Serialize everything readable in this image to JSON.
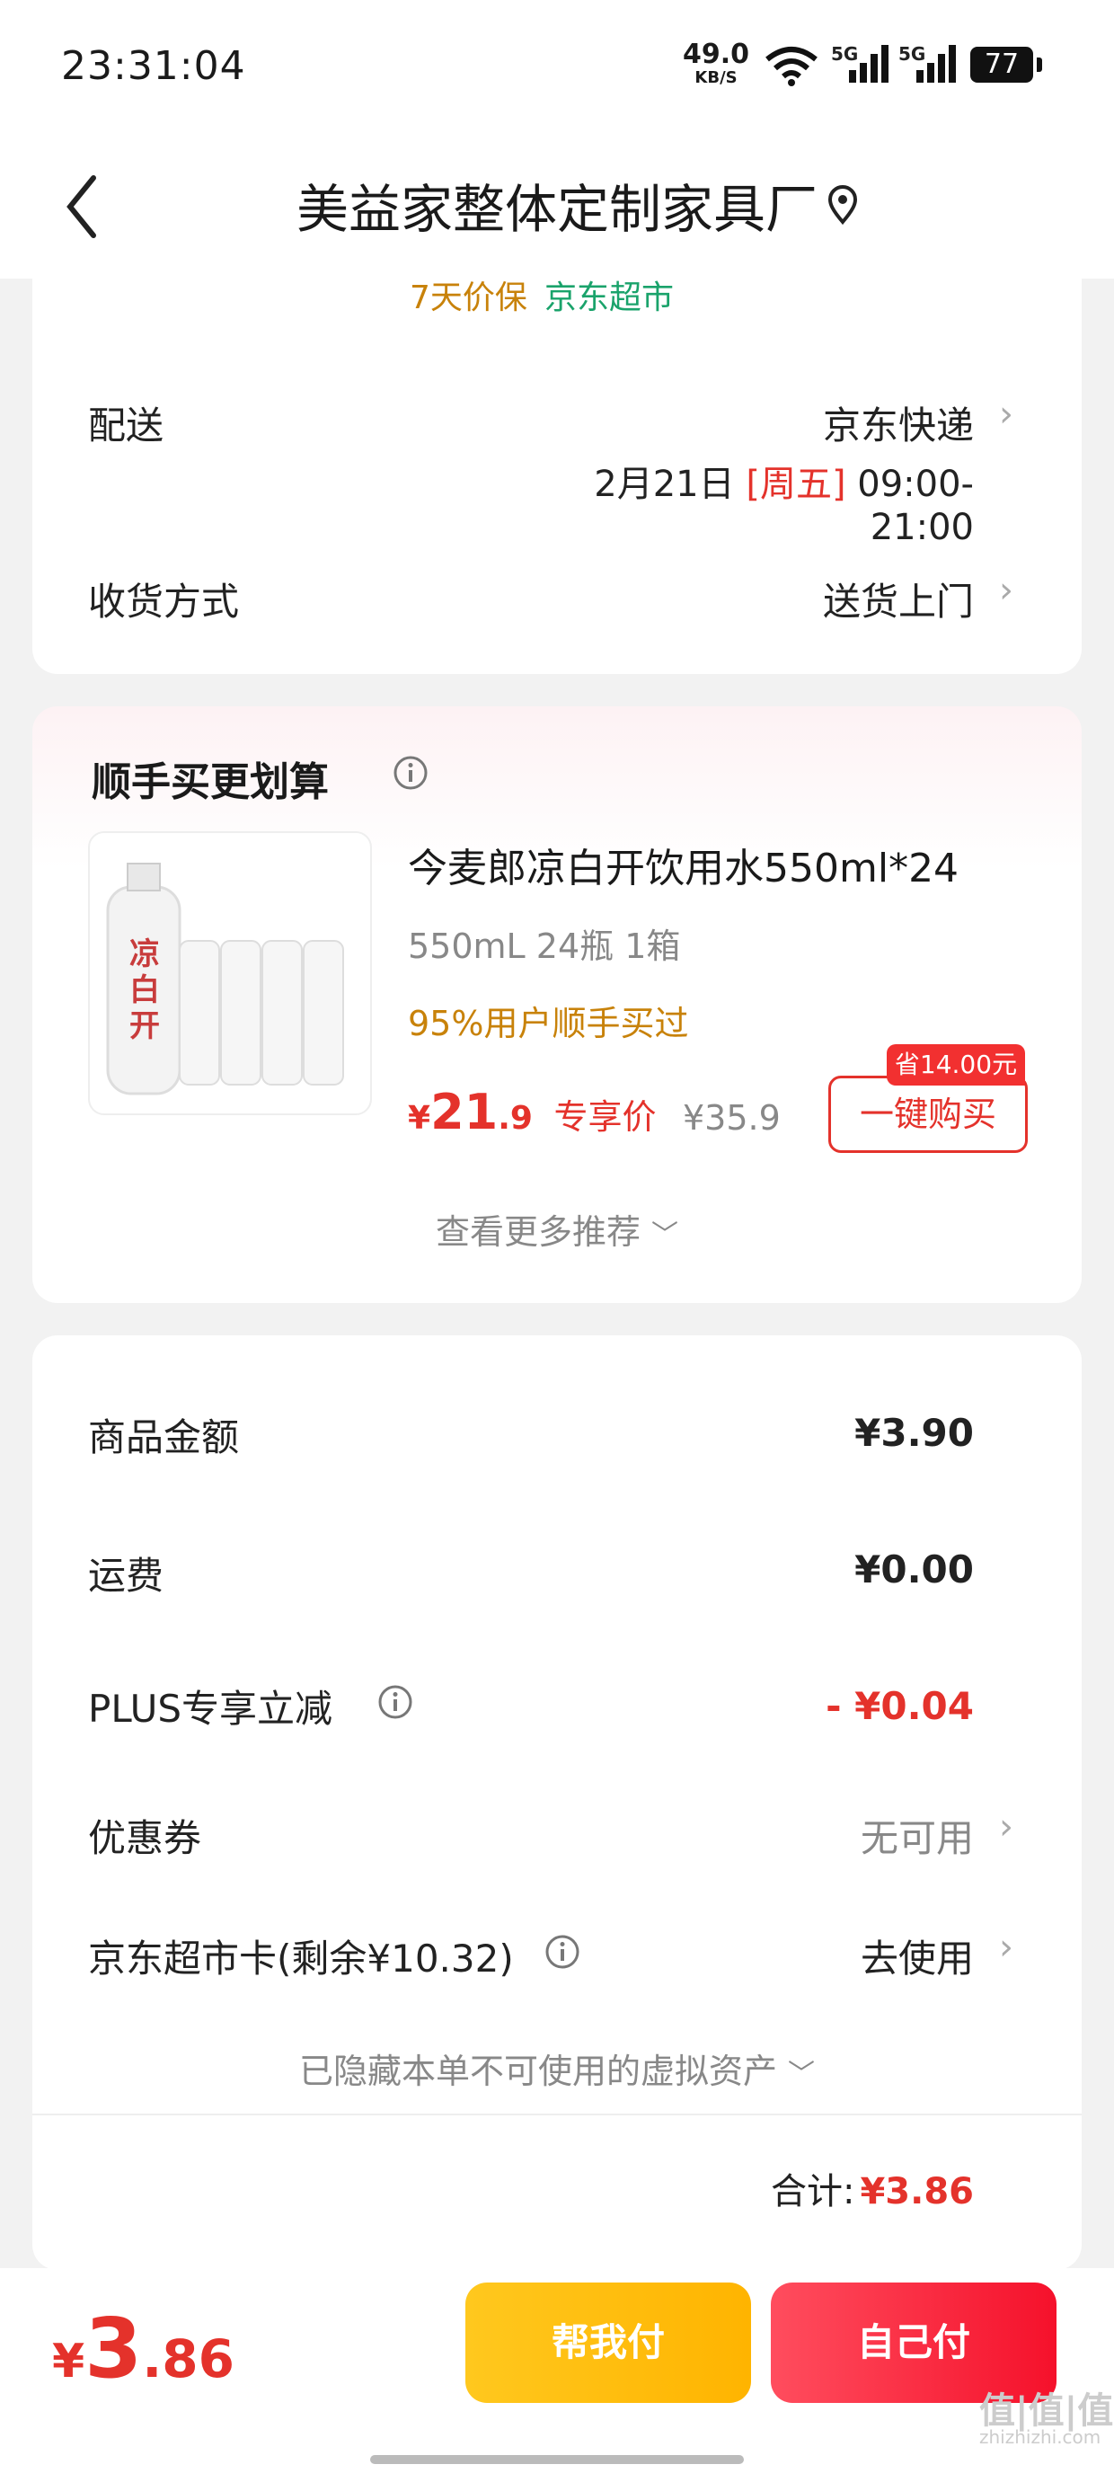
{
  "status": {
    "time": "23:31:04",
    "speed": "49.0",
    "speed_unit": "KB/S",
    "signal1": "5G",
    "signal2": "5G",
    "battery": "77"
  },
  "header": {
    "title": "美益家整体定制家具厂"
  },
  "tags": {
    "price_protect": "7天价保",
    "supermarket": "京东超市"
  },
  "delivery": {
    "label": "配送",
    "carrier": "京东快递",
    "date": "2月21日",
    "weekday": "[周五]",
    "time_range": "09:00-21:00"
  },
  "receive": {
    "label": "收货方式",
    "value": "送货上门"
  },
  "addon": {
    "title": "顺手买更划算",
    "product_name": "今麦郎凉白开饮用水550ml*24",
    "product_image_text": "凉白开",
    "spec": "550mL 24瓶 1箱",
    "social": "95%用户顺手买过",
    "price_symbol": "¥",
    "price_int": "21",
    "price_dec": ".9",
    "price_label": "专享价",
    "orig_price": "¥35.9",
    "save_badge": "省14.00元",
    "buy_label": "一键购买",
    "more": "查看更多推荐"
  },
  "summary": {
    "goods_label": "商品金额",
    "goods_value": "¥3.90",
    "ship_label": "运费",
    "ship_value": "¥0.00",
    "plus_label": "PLUS专享立减",
    "plus_value": "- ¥0.04",
    "coupon_label": "优惠券",
    "coupon_value": "无可用",
    "card_label": "京东超市卡(剩余¥10.32)",
    "card_value": "去使用",
    "hidden_note": "已隐藏本单不可使用的虚拟资产",
    "total_label": "合计:",
    "total_value": "¥3.86"
  },
  "bottom": {
    "currency": "¥",
    "amount_int": "3",
    "amount_dec": ".86",
    "help_pay": "帮我付",
    "self_pay": "自己付"
  },
  "watermark": {
    "main": "值|值|值",
    "sub": "zhizhizhi.com"
  },
  "colors": {
    "accent_red": "#e4322b",
    "tag_orange": "#c8820a",
    "tag_green": "#1aa36b"
  }
}
